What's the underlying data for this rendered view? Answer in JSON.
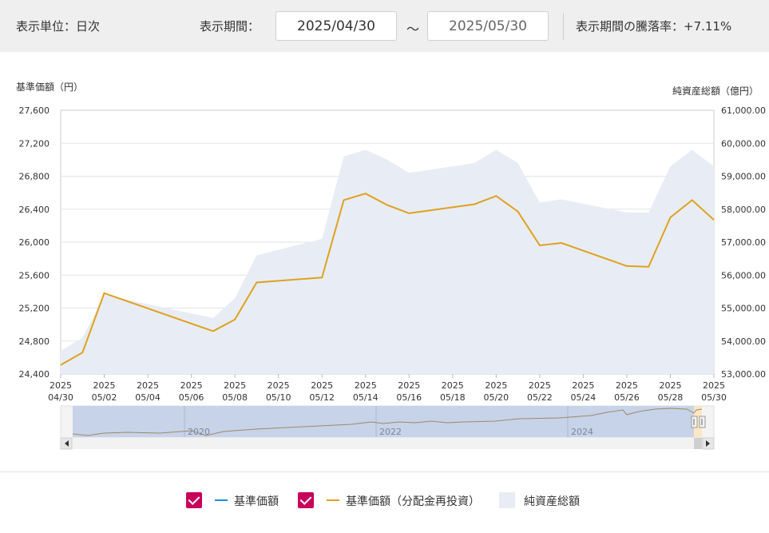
{
  "header": {
    "unit_label": "表示単位：日次",
    "period_label": "表示期間：",
    "start_date": "2025/04/30",
    "tilde": "～",
    "end_date": "2025/05/30",
    "change_label": "表示期間の騰落率：+7.11%"
  },
  "chart_data": {
    "type": "line",
    "ylabel": "基準価額（円）",
    "y2label": "純資産総額（億円）",
    "ylim": [
      24400,
      27600
    ],
    "y2lim": [
      53000,
      61000
    ],
    "yticks": [
      "27,600",
      "27,200",
      "26,800",
      "26,400",
      "26,000",
      "25,600",
      "25,200",
      "24,800",
      "24,400"
    ],
    "y2ticks": [
      "61,000.00",
      "60,000.00",
      "59,000.00",
      "58,000.00",
      "57,000.00",
      "56,000.00",
      "55,000.00",
      "54,000.00",
      "53,000.00"
    ],
    "xticks": [
      [
        "2025",
        "04/30"
      ],
      [
        "2025",
        "05/02"
      ],
      [
        "2025",
        "05/04"
      ],
      [
        "2025",
        "05/06"
      ],
      [
        "2025",
        "05/08"
      ],
      [
        "2025",
        "05/10"
      ],
      [
        "2025",
        "05/12"
      ],
      [
        "2025",
        "05/14"
      ],
      [
        "2025",
        "05/16"
      ],
      [
        "2025",
        "05/18"
      ],
      [
        "2025",
        "05/20"
      ],
      [
        "2025",
        "05/22"
      ],
      [
        "2025",
        "05/24"
      ],
      [
        "2025",
        "05/26"
      ],
      [
        "2025",
        "05/28"
      ],
      [
        "2025",
        "05/30"
      ]
    ],
    "x": [
      "2025/04/30",
      "2025/05/01",
      "2025/05/02",
      "2025/05/07",
      "2025/05/08",
      "2025/05/09",
      "2025/05/12",
      "2025/05/13",
      "2025/05/14",
      "2025/05/15",
      "2025/05/16",
      "2025/05/19",
      "2025/05/20",
      "2025/05/21",
      "2025/05/22",
      "2025/05/23",
      "2025/05/26",
      "2025/05/27",
      "2025/05/28",
      "2025/05/29",
      "2025/05/30"
    ],
    "series": [
      {
        "name": "基準価額（分配金再投資）",
        "axis": "left",
        "color": "#e0a020",
        "values": [
          24510,
          24660,
          25380,
          24920,
          25060,
          25510,
          25570,
          26510,
          26590,
          26450,
          26350,
          26460,
          26560,
          26370,
          25960,
          25990,
          25710,
          25700,
          26300,
          26510,
          26270
        ]
      },
      {
        "name": "純資産総額",
        "axis": "right",
        "color": "#e8edf5",
        "values": [
          53700,
          54100,
          55400,
          54700,
          55300,
          56600,
          57100,
          59600,
          59800,
          59500,
          59100,
          59400,
          59800,
          59400,
          58200,
          58300,
          57900,
          57900,
          59300,
          59800,
          59300
        ]
      }
    ],
    "grid": true,
    "legend_position": "bottom"
  },
  "navigator": {
    "year_labels": [
      "2020",
      "2022",
      "2024"
    ]
  },
  "legend": {
    "items": [
      {
        "label": "基準価額",
        "color": "#1a8fdf",
        "checked": true
      },
      {
        "label": "基準価額（分配金再投資）",
        "color": "#e0a020",
        "checked": true
      },
      {
        "label": "純資産総額",
        "color": "#e8edf5"
      }
    ]
  }
}
